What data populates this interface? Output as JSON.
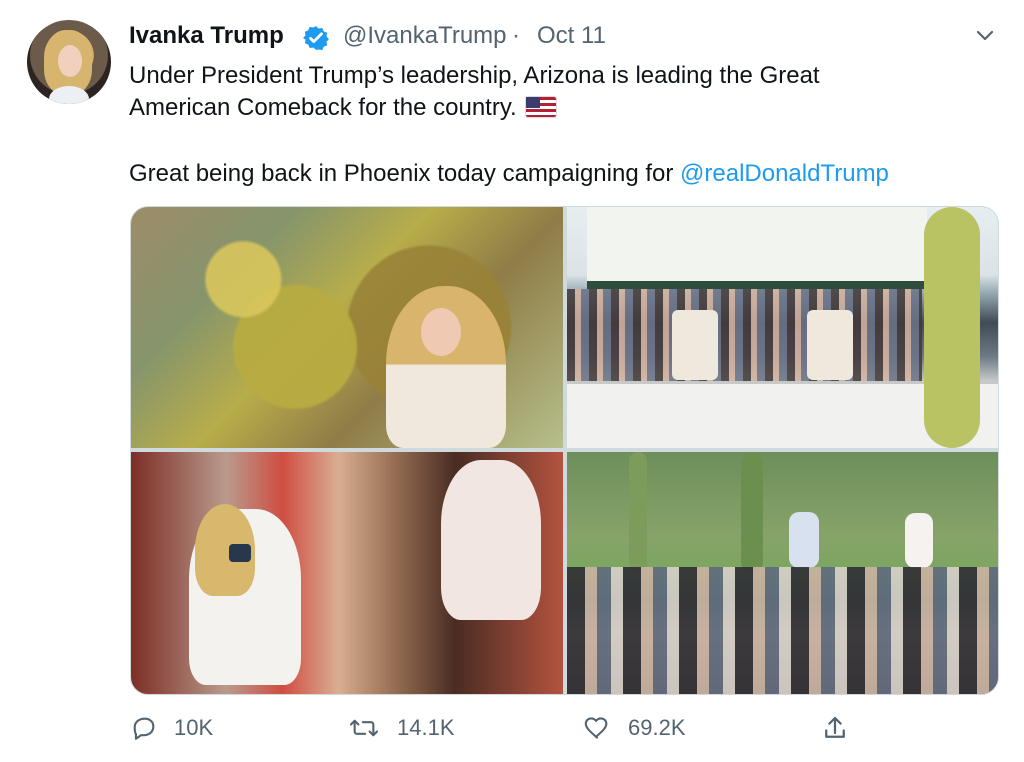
{
  "tweet": {
    "author_name": "Ivanka Trump",
    "handle": "@IvankaTrump",
    "separator": "·",
    "date": "Oct 11",
    "text_line_1": "Under President Trump’s leadership, Arizona is leading the Great",
    "text_line_2": "American Comeback for the country.",
    "text_line_3_prefix": "Great being back in Phoenix today campaigning for ",
    "mention": "@realDonaldTrump",
    "stats": {
      "replies": "10K",
      "retweets": "14.1K",
      "likes": "69.2K"
    }
  },
  "icons": {
    "verified": "verified-badge-icon",
    "menu": "chevron-down-icon",
    "reply": "reply-icon",
    "retweet": "retweet-icon",
    "like": "heart-icon",
    "share": "share-icon"
  },
  "colors": {
    "text": "#0f1419",
    "secondary": "#536471",
    "link": "#1d9bf0",
    "verified": "#1d9bf0",
    "border": "#cfd9de"
  }
}
